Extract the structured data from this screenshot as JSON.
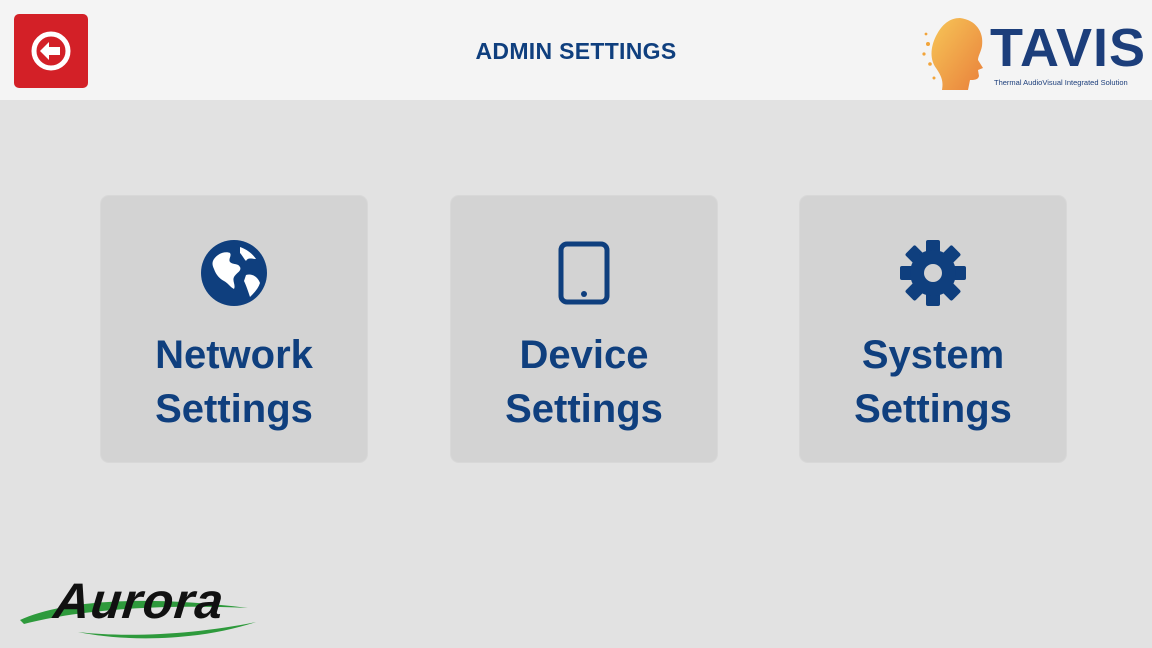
{
  "header": {
    "title": "ADMIN SETTINGS",
    "back_icon": "back-arrow-icon",
    "back_color": "#d32027",
    "logo": {
      "word": "TAVIS",
      "tagline": "Thermal AudioVisual Integrated Solution"
    }
  },
  "tiles": [
    {
      "icon": "globe-icon",
      "line1": "Network",
      "line2": "Settings"
    },
    {
      "icon": "tablet-icon",
      "line1": "Device",
      "line2": "Settings"
    },
    {
      "icon": "gear-icon",
      "line1": "System",
      "line2": "Settings"
    }
  ],
  "footer": {
    "brand": "Aurora"
  },
  "colors": {
    "accent": "#0f3f7e",
    "background": "#e2e2e2",
    "tile": "#d3d3d3",
    "header": "#f4f4f4"
  }
}
